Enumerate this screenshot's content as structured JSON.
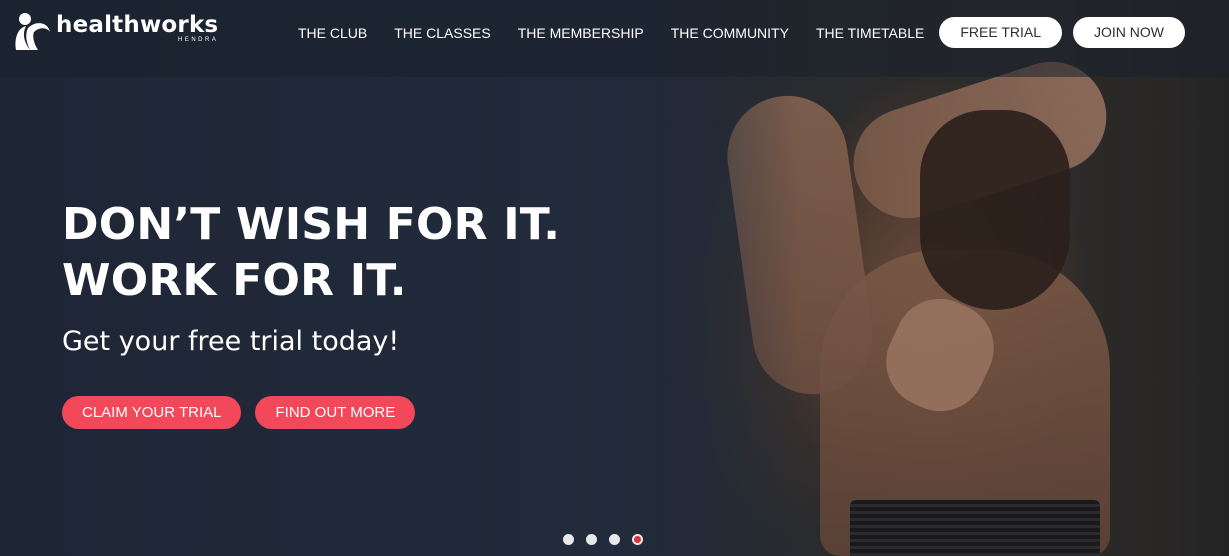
{
  "brand": {
    "name": "healthworks",
    "location": "HENDRA"
  },
  "nav": {
    "links": [
      "THE CLUB",
      "THE CLASSES",
      "THE MEMBERSHIP",
      "THE COMMUNITY",
      "THE TIMETABLE"
    ],
    "free_trial_label": "FREE TRIAL",
    "join_now_label": "JOIN NOW"
  },
  "hero": {
    "headline_line1": "DON’T WISH FOR IT.",
    "headline_line2": "WORK FOR IT.",
    "subheadline": "Get your free trial today!",
    "cta_primary": "CLAIM YOUR TRIAL",
    "cta_secondary": "FIND OUT MORE"
  },
  "carousel": {
    "slide_count": 4,
    "active_slide": 4
  },
  "colors": {
    "accent": "#f2485a",
    "header_bg": "#1a202c",
    "hero_bg": "#222b3b",
    "active_dot": "#d8323f"
  }
}
